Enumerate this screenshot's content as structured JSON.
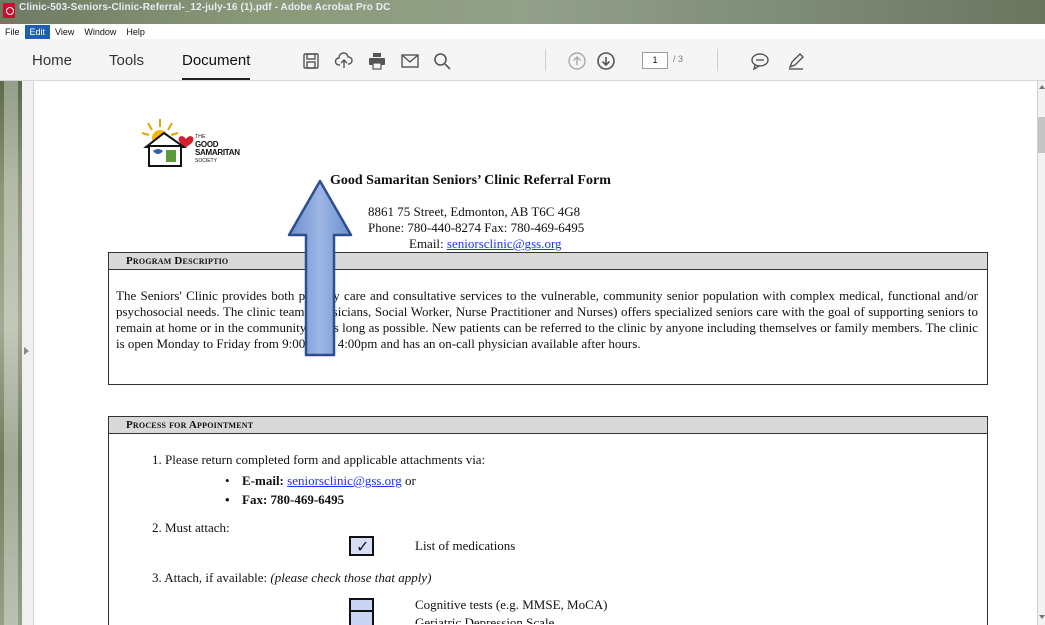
{
  "window": {
    "title": "Clinic-503-Seniors-Clinic-Referral-_12-july-16 (1).pdf - Adobe Acrobat Pro DC"
  },
  "menu": [
    "File",
    "Edit",
    "View",
    "Window",
    "Help"
  ],
  "toolbar": {
    "tabs": [
      "Home",
      "Tools",
      "Document"
    ],
    "active_tab": "Document",
    "page_current": "1",
    "page_total": "/ 3",
    "icons": [
      "save-icon",
      "upload-icon",
      "print-icon",
      "email-icon",
      "search-icon",
      "previous-page-icon",
      "next-page-icon",
      "comment-icon",
      "sign-icon"
    ]
  },
  "document": {
    "logo": {
      "line1": "THE",
      "line2": "GOOD",
      "line3": "SAMARITAN",
      "line4": "SOCIETY"
    },
    "title": "Good Samaritan  Seniors’ Clinic  Referral Form",
    "address": "8861 75 Street, Edmonton,  AB T6C 4G8",
    "phone": "Phone: 780-440-8274 Fax: 780-469-6495",
    "email_label": "Email:",
    "email": "seniorsclinic@gss.org",
    "program_section": {
      "heading": "Program Descriptio",
      "text": "The Seniors' Clinic  provides  both primary care and consultative  services to the vulnerable,  community senior population with complex medical, functional and/or psychosocial needs. The clinic team (Physicians, Social Worker, Nurse Practitioner and Nurses) offers specialized seniors care with the goal of supporting seniors to remain at home or in the community for as long as possible. New patients can be referred to the clinic by anyone including themselves or family members. The clinic is open Monday to Friday from 9:00am to 4:00pm and has an on-call physician available after hours."
    },
    "process_section": {
      "heading": "Process for Appointment",
      "step1": "1.  Please return completed form and applicable attachments via:",
      "email_bullet_label": "E-mail:",
      "email_bullet_link": "seniorsclinic@gss.org",
      "email_bullet_suffix": "or",
      "fax_bullet": "Fax: 780-469-6495",
      "step2": "2.  Must attach:",
      "step2_item": "List of medications",
      "step3": "3.  Attach, if available:",
      "step3_note": "(please check those that apply)",
      "step3_item1": "Cognitive tests (e.g. MMSE, MoCA)",
      "step3_item2": "Geriatric Depression Scale"
    }
  },
  "colors": {
    "link": "#1a33ff",
    "arrow_fill": "#7d9fd6",
    "arrow_stroke": "#2e4f8c",
    "section_header_bg": "#d9d9d9"
  }
}
